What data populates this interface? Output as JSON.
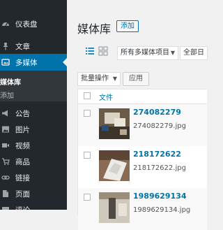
{
  "sidebar": {
    "items": [
      {
        "label": "仪表盘",
        "icon": "dashboard-icon"
      },
      {
        "label": "文章",
        "icon": "pushpin-icon"
      },
      {
        "label": "多媒体",
        "icon": "media-icon",
        "current": true
      },
      {
        "label": "公告",
        "icon": "megaphone-icon"
      },
      {
        "label": "图片",
        "icon": "image-icon"
      },
      {
        "label": "视频",
        "icon": "video-icon"
      },
      {
        "label": "商品",
        "icon": "cart-icon"
      },
      {
        "label": "链接",
        "icon": "link-icon"
      },
      {
        "label": "页面",
        "icon": "page-icon"
      },
      {
        "label": "评论",
        "icon": "comment-icon"
      }
    ],
    "submenu": {
      "active": "媒体库",
      "other": "添加"
    }
  },
  "main": {
    "title": "媒体库",
    "add_new": "添加",
    "filter_type": "所有多媒体项目",
    "filter_date": "全部日",
    "bulk_action": "批量操作",
    "apply": "应用",
    "column_file": "文件"
  },
  "media_rows": [
    {
      "title": "274082279",
      "filename": "274082279.jpg"
    },
    {
      "title": "218172622",
      "filename": "218172622.jpg"
    },
    {
      "title": "1989629134",
      "filename": "1989629134.jpg"
    }
  ],
  "colors": {
    "sidebar_bg": "#23282d",
    "accent": "#0073aa",
    "page_bg": "#f1f1f1"
  }
}
